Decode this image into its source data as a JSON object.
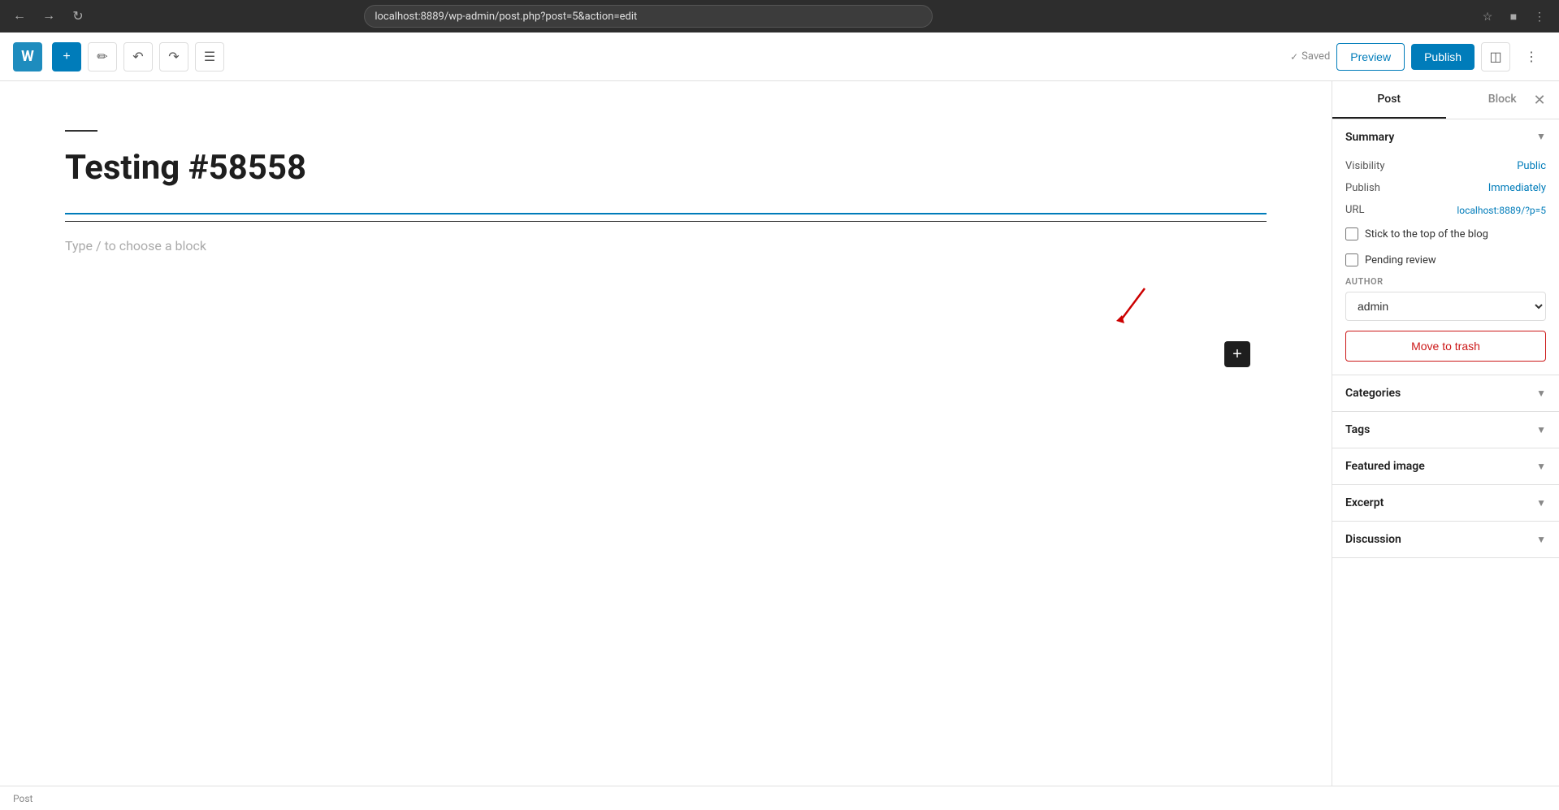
{
  "browser": {
    "url": "localhost:8889/wp-admin/post.php?post=5&action=edit",
    "back_title": "Back",
    "forward_title": "Forward",
    "refresh_title": "Refresh"
  },
  "toolbar": {
    "add_label": "+",
    "edit_label": "✎",
    "undo_label": "↩",
    "redo_label": "↪",
    "list_view_label": "☰",
    "saved_label": "Saved",
    "preview_label": "Preview",
    "publish_label": "Publish",
    "settings_icon_label": "⬛",
    "options_label": "⋮"
  },
  "editor": {
    "separator": "",
    "title": "Testing #58558",
    "placeholder": "Type / to choose a block"
  },
  "sidebar": {
    "tabs": [
      {
        "label": "Post",
        "active": true
      },
      {
        "label": "Block",
        "active": false
      }
    ],
    "summary_label": "Summary",
    "visibility_label": "Visibility",
    "visibility_value": "Public",
    "publish_label": "Publish",
    "publish_value": "Immediately",
    "url_label": "URL",
    "url_value": "localhost:8889/?p=5",
    "stick_to_top_label": "Stick to the top of the blog",
    "pending_review_label": "Pending review",
    "author_label": "AUTHOR",
    "author_value": "admin",
    "author_options": [
      "admin"
    ],
    "trash_label": "Move to trash",
    "categories_label": "Categories",
    "tags_label": "Tags",
    "featured_image_label": "Featured image",
    "excerpt_label": "Excerpt",
    "discussion_label": "Discussion"
  },
  "status_bar": {
    "label": "Post"
  }
}
